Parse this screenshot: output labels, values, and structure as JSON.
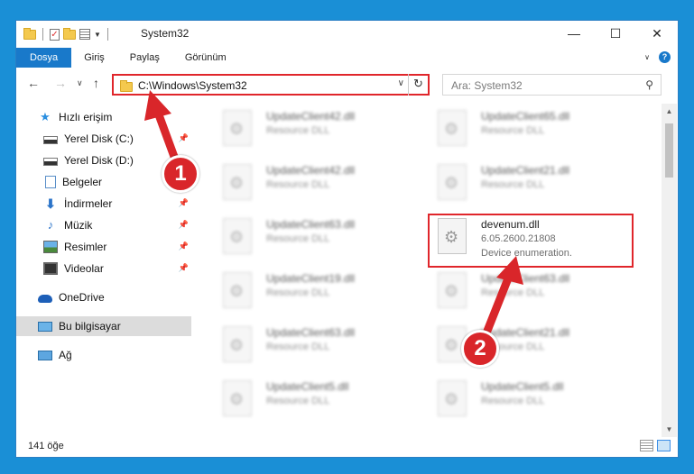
{
  "window": {
    "title": "System32",
    "controls": {
      "minimize": "—",
      "maximize": "☐",
      "close": "✕"
    }
  },
  "ribbon": {
    "tabs": [
      "Dosya",
      "Giriş",
      "Paylaş",
      "Görünüm"
    ]
  },
  "address": {
    "path": "C:\\Windows\\System32",
    "search_placeholder": "Ara: System32"
  },
  "sidebar": {
    "items": [
      {
        "label": "Hızlı erişim",
        "icon": "star-icon"
      },
      {
        "label": "Yerel Disk (C:)",
        "icon": "disk-icon",
        "pinned": true
      },
      {
        "label": "Yerel Disk (D:)",
        "icon": "disk-icon",
        "pinned": false
      },
      {
        "label": "Belgeler",
        "icon": "documents-icon",
        "pinned": true
      },
      {
        "label": "İndirmeler",
        "icon": "download-icon",
        "pinned": true
      },
      {
        "label": "Müzik",
        "icon": "music-icon",
        "pinned": true
      },
      {
        "label": "Resimler",
        "icon": "pictures-icon",
        "pinned": true
      },
      {
        "label": "Videolar",
        "icon": "videos-icon",
        "pinned": true
      },
      {
        "label": "OneDrive",
        "icon": "onedrive-icon"
      },
      {
        "label": "Bu bilgisayar",
        "icon": "computer-icon",
        "selected": true
      },
      {
        "label": "Ağ",
        "icon": "network-icon"
      }
    ]
  },
  "files": {
    "left_column": [
      {
        "name": "UpdateClient42.dll",
        "desc": "Resource DLL"
      },
      {
        "name": "UpdateClient42.dll",
        "desc": "Resource DLL"
      },
      {
        "name": "UpdateClient63.dll",
        "desc": "Resource DLL"
      },
      {
        "name": "UpdateClient19.dll",
        "desc": "Resource DLL"
      },
      {
        "name": "UpdateClient63.dll",
        "desc": "Resource DLL"
      },
      {
        "name": "UpdateClient5.dll",
        "desc": "Resource DLL"
      }
    ],
    "right_column": [
      {
        "name": "UpdateClient65.dll",
        "desc": "Resource DLL"
      },
      {
        "name": "UpdateClient21.dll",
        "desc": "Resource DLL"
      },
      {
        "name": "UpdateClient63.dll",
        "desc": "Resource DLL"
      },
      {
        "name": "UpdateClient21.dll",
        "desc": "Resource DLL"
      },
      {
        "name": "UpdateClient5.dll",
        "desc": "Resource DLL"
      }
    ],
    "highlighted": {
      "name": "devenum.dll",
      "version": "6.05.2600.21808",
      "desc": "Device enumeration."
    }
  },
  "status": {
    "count": "141 öğe"
  },
  "annotations": {
    "step1": "1",
    "step2": "2",
    "color": "#d9262a"
  }
}
